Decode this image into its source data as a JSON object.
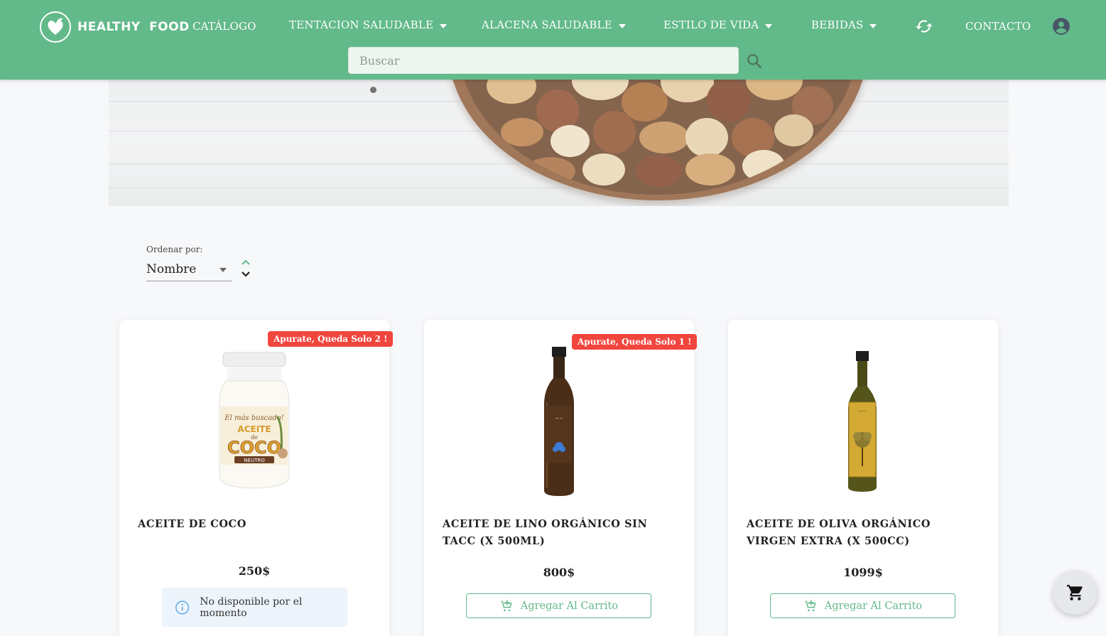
{
  "header": {
    "logo_text": "HEALTHY FOOD",
    "nav": {
      "catalog": "CATÁLOGO",
      "tentacion": "TENTACION SALUDABLE",
      "alacena": "ALACENA SALUDABLE",
      "estilo": "ESTILO DE VIDA",
      "bebidas": "BEBIDAS",
      "contacto": "CONTACTO"
    },
    "search_placeholder": "Buscar"
  },
  "sort": {
    "label": "Ordenar por:",
    "selected": "Nombre"
  },
  "products": [
    {
      "name": "ACEITE DE COCO",
      "price": "250$",
      "badge": "Apurate, Queda Solo 2 !",
      "status": "No disponible por el momento"
    },
    {
      "name": "ACEITE DE LINO ORGÁNICO SIN TACC (X 500ML)",
      "price": "800$",
      "badge": "Apurate, Queda Solo 1 !",
      "button": "Agregar Al Carrito"
    },
    {
      "name": "ACEITE DE OLIVA ORGÁNICO VIRGEN EXTRA (X 500CC)",
      "price": "1099$",
      "button": "Agregar Al Carrito"
    }
  ],
  "product_labels": {
    "coco_jar_top": "El más buscado!",
    "coco_jar_mid": "ACEITE",
    "coco_jar_de": "de",
    "coco_jar_big": "COCO",
    "coco_jar_neutro": "NEUTRO"
  },
  "colors": {
    "header_green": "#62b98a",
    "badge_red": "#f0463e",
    "button_green": "#62b98a",
    "info_blue": "#5aa8e6"
  },
  "icons": {
    "logo": "heart-leaf-icon",
    "sync": "sync-icon",
    "account": "account-circle-icon",
    "search": "search-icon",
    "cart": "cart-icon",
    "add_cart": "add-cart-icon",
    "info": "info-icon"
  }
}
